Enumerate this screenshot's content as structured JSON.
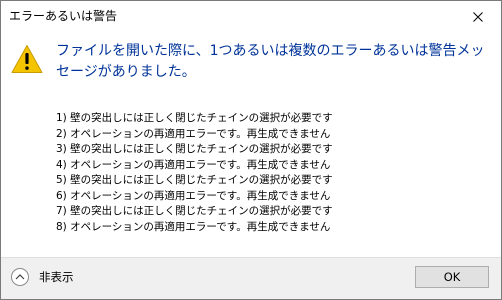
{
  "window": {
    "title": "エラーあるいは警告",
    "close_icon": "close-icon"
  },
  "main": {
    "warning_icon": "warning-icon",
    "instruction": "ファイルを開いた際に、1つあるいは複数のエラーあるいは警告メッセージがありました。",
    "messages": [
      "1) 壁の突出しには正しく閉じたチェインの選択が必要です",
      "2) オペレーションの再適用エラーです。再生成できません",
      "3) 壁の突出しには正しく閉じたチェインの選択が必要です",
      "4) オペレーションの再適用エラーです。再生成できません",
      "5) 壁の突出しには正しく閉じたチェインの選択が必要です",
      "6) オペレーションの再適用エラーです。再生成できません",
      "7) 壁の突出しには正しく閉じたチェインの選択が必要です",
      "8) オペレーションの再適用エラーです。再生成できません"
    ]
  },
  "footer": {
    "expander_icon": "chevron-up-icon",
    "expander_label": "非表示",
    "ok_label": "OK"
  },
  "colors": {
    "instruction": "#003399",
    "warning_fill": "#f5c400",
    "footer_bg": "#f0f0f0"
  }
}
